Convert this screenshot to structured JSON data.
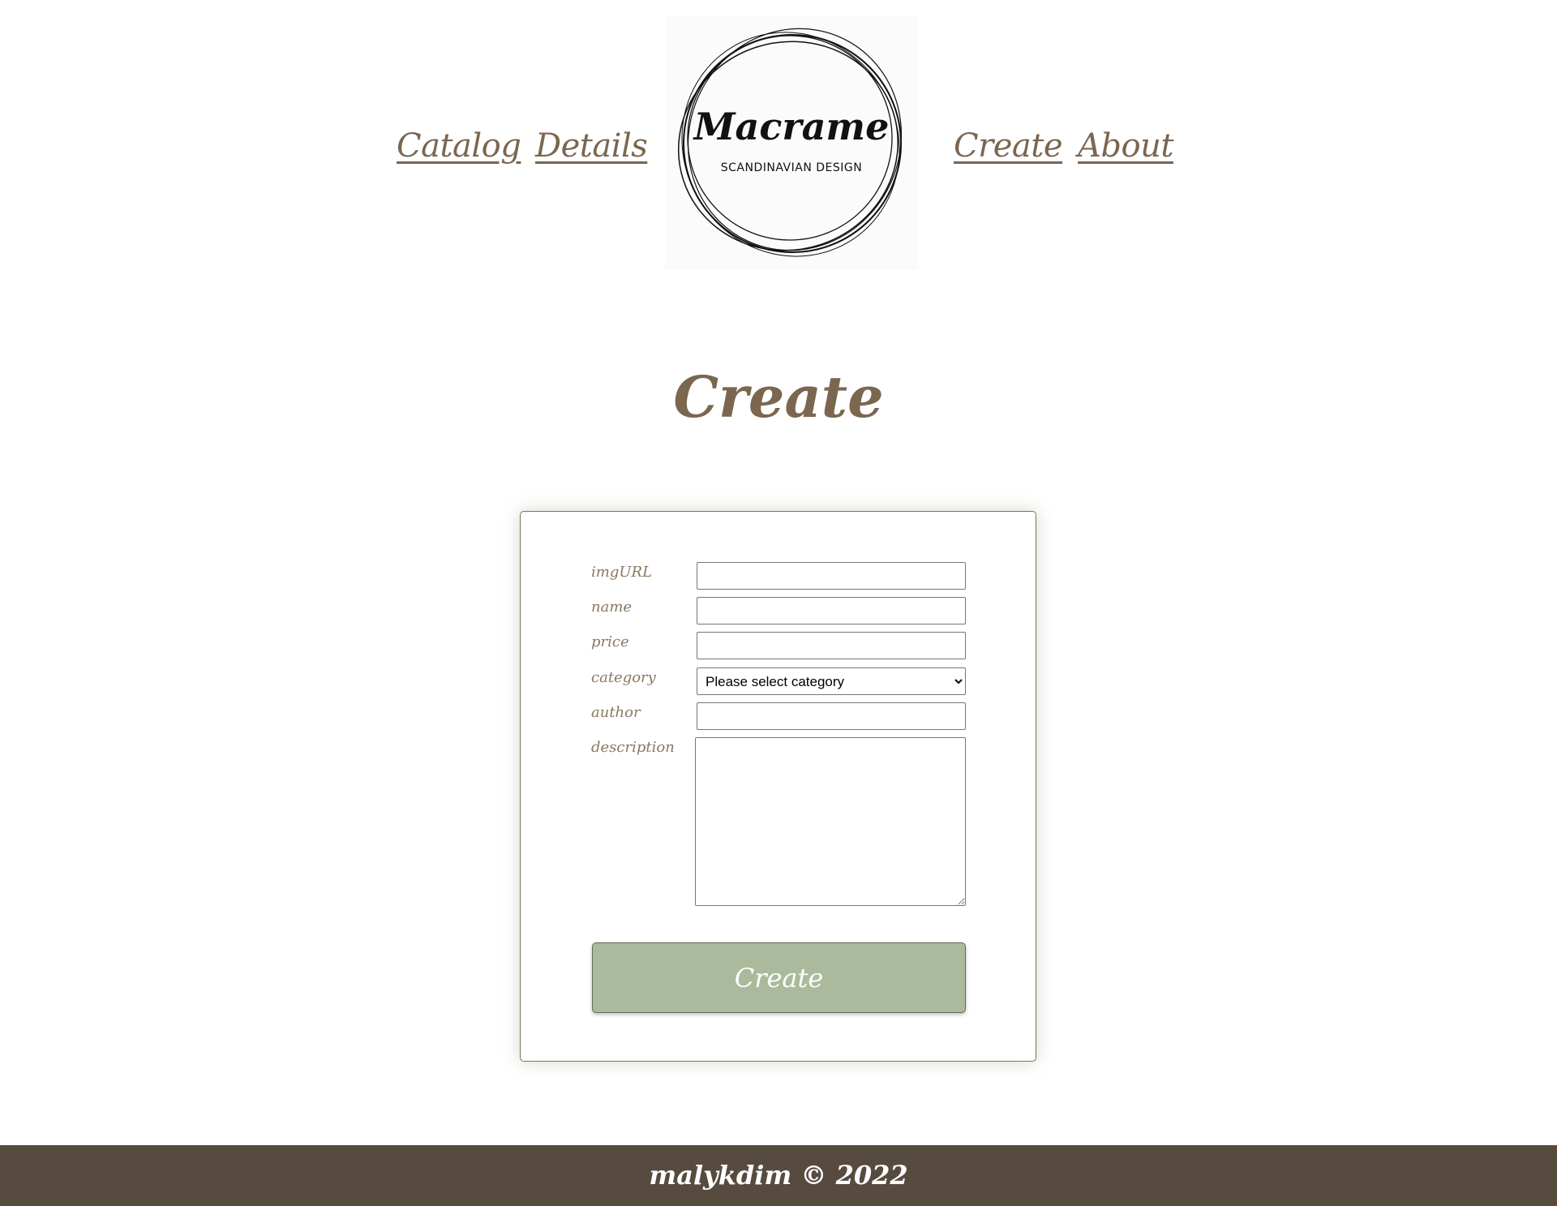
{
  "nav": {
    "catalog": "Catalog",
    "details": "Details",
    "create": "Create",
    "about": "About"
  },
  "logo": {
    "title": "Macrame",
    "subtitle": "SCANDINAVIAN DESIGN"
  },
  "page": {
    "title": "Create"
  },
  "form": {
    "imgurl_label": "imgURL",
    "imgurl_value": "",
    "name_label": "name",
    "name_value": "",
    "price_label": "price",
    "price_value": "",
    "category_label": "category",
    "category_selected": "Please select category",
    "author_label": "author",
    "author_value": "",
    "description_label": "description",
    "description_value": "",
    "submit_label": "Create"
  },
  "footer": {
    "text": "malykdim © 2022"
  },
  "colors": {
    "brand_brown": "#7b6650",
    "button_green": "#abba9c",
    "footer_bg": "#574b3f"
  }
}
